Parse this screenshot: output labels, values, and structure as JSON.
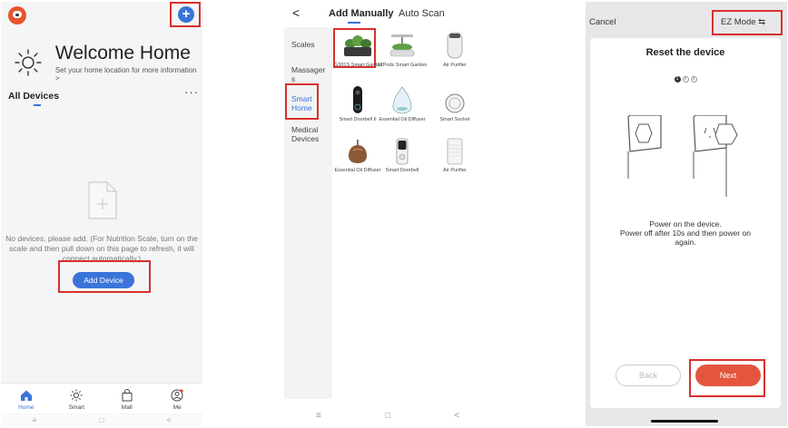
{
  "screen1": {
    "welcome_title": "Welcome Home",
    "welcome_subtitle": "Set your home location for more information >",
    "section_title": "All Devices",
    "more_label": "···",
    "add_icon": "+",
    "empty_message": "No devices, please add. (For Nutrition Scale, turn on the scale and then pull down on this page to refresh, it will connect automatically.)",
    "add_device_label": "Add Device",
    "tabs": [
      {
        "label": "Home",
        "icon": "house-icon",
        "active": true
      },
      {
        "label": "Smart",
        "icon": "sun-icon",
        "active": false
      },
      {
        "label": "Mall",
        "icon": "bag-icon",
        "active": false
      },
      {
        "label": "Me",
        "icon": "user-icon",
        "active": false
      }
    ],
    "nav": [
      "≡",
      "□",
      "<"
    ],
    "accent_color": "#3a74d9"
  },
  "screen2": {
    "back_label": "<",
    "tab_manual": "Add Manually",
    "tab_auto": "Auto Scan",
    "categories": [
      "Scales",
      "Massager s",
      "Smart Home",
      "Medical Devices"
    ],
    "active_category": "Smart Home",
    "devices": [
      {
        "name": "IG301S Smart Garden"
      },
      {
        "name": "12Pods Smart Garden"
      },
      {
        "name": "Air Purifier"
      },
      {
        "name": "Smart Doorbell II"
      },
      {
        "name": "Essential Oil Diffuser"
      },
      {
        "name": "Smart Socket"
      },
      {
        "name": "Essential Oil Diffuser"
      },
      {
        "name": "Smart Doorbell"
      },
      {
        "name": "Air Purifier"
      }
    ],
    "nav": [
      "≡",
      "□",
      "<"
    ]
  },
  "screen3": {
    "cancel_label": "Cancel",
    "mode_label": "EZ Mode ⇆",
    "title": "Reset the device",
    "steps": [
      "1",
      "2",
      "3"
    ],
    "active_step": 1,
    "instruction_line1": "Power on the device.",
    "instruction_line2": "Power off after 10s and then power on again.",
    "back_label": "Back",
    "next_label": "Next",
    "next_color": "#e3553d"
  },
  "highlight_color": "#d9302c"
}
